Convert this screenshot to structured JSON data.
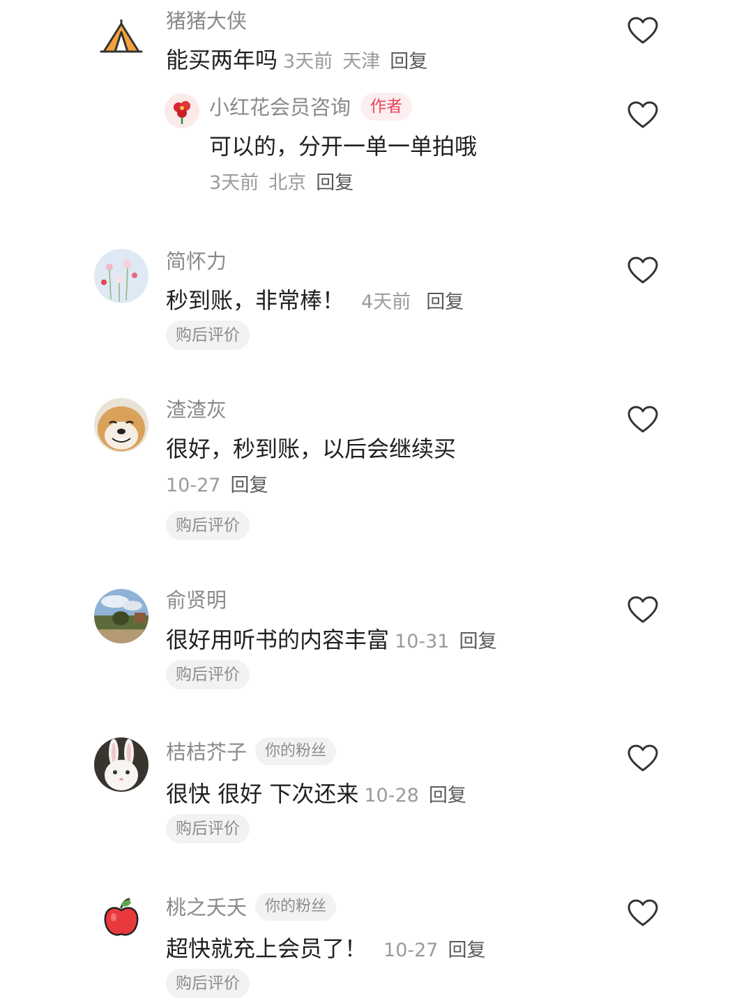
{
  "comments": [
    {
      "user": "猪猪大侠",
      "text": "能买两年吗",
      "time": "3天前",
      "location": "天津",
      "reply_label": "回复",
      "avatar_icon": "tent-icon",
      "replies": [
        {
          "user": "小红花会员咨询",
          "author_badge": "作者",
          "text": "可以的，分开一单一单拍哦",
          "time": "3天前",
          "location": "北京",
          "reply_label": "回复",
          "avatar_icon": "red-flower-icon"
        }
      ]
    },
    {
      "user": "简怀力",
      "text": "秒到账，非常棒！",
      "time": "4天前",
      "reply_label": "回复",
      "tag": "购后评价",
      "avatar_icon": "flower-photo-avatar"
    },
    {
      "user": "渣渣灰",
      "text": "很好，秒到账，以后会继续买",
      "time": "10-27",
      "reply_label": "回复",
      "tag": "购后评价",
      "avatar_icon": "shiba-dog-avatar"
    },
    {
      "user": "俞贤明",
      "text": "很好用听书的内容丰富",
      "time": "10-31",
      "reply_label": "回复",
      "tag": "购后评价",
      "avatar_icon": "landscape-photo-avatar"
    },
    {
      "user": "桔桔芥子",
      "fan_badge": "你的粉丝",
      "text": "很快 很好 下次还来",
      "time": "10-28",
      "reply_label": "回复",
      "tag": "购后评价",
      "avatar_icon": "white-rabbit-avatar"
    },
    {
      "user": "桃之夭夭",
      "fan_badge": "你的粉丝",
      "text": "超快就充上会员了！",
      "time": "10-27",
      "reply_label": "回复",
      "tag": "购后评价",
      "avatar_icon": "red-apple-icon"
    }
  ],
  "colors": {
    "name": "#8a8a8a",
    "content": "#1f1f1f",
    "meta": "#9a9a9a",
    "author_badge_bg": "#fdeef0",
    "author_badge_text": "#e8465b",
    "tag_bg": "#f2f2f2"
  }
}
